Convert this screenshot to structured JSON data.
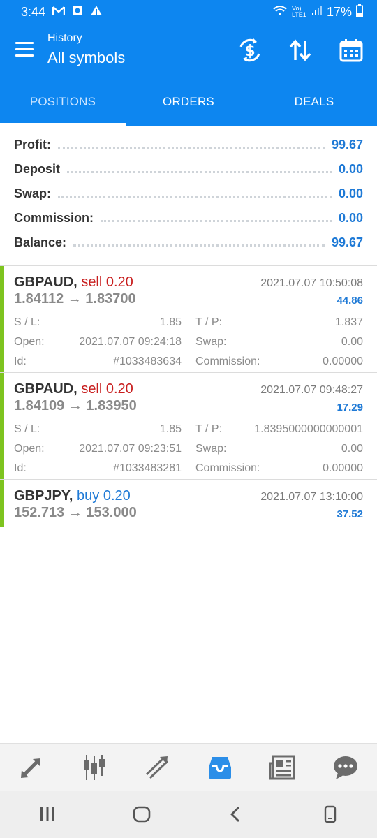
{
  "status_bar": {
    "time": "3:44",
    "battery": "17%",
    "signal_label": "Vo) LTE1"
  },
  "app_bar": {
    "subtitle": "History",
    "title": "All symbols"
  },
  "tabs": [
    {
      "label": "POSITIONS"
    },
    {
      "label": "ORDERS"
    },
    {
      "label": "DEALS"
    }
  ],
  "summary": [
    {
      "label": "Profit:",
      "value": "99.67"
    },
    {
      "label": "Deposit",
      "value": "0.00"
    },
    {
      "label": "Swap:",
      "value": "0.00"
    },
    {
      "label": "Commission:",
      "value": "0.00"
    },
    {
      "label": "Balance:",
      "value": "99.67"
    }
  ],
  "trades": [
    {
      "symbol": "GBPAUD,",
      "direction": "sell 0.20",
      "time": "2021.07.07 10:50:08",
      "prices": "1.84112 → 1.83700",
      "profit": "44.86",
      "sl_label": "S / L:",
      "sl": "1.85",
      "tp_label": "T / P:",
      "tp": "1.837",
      "open_label": "Open:",
      "open": "2021.07.07 09:24:18",
      "swap_label": "Swap:",
      "swap": "0.00",
      "id_label": "Id:",
      "id": "#1033483634",
      "commission_label": "Commission:",
      "commission": "0.00000"
    },
    {
      "symbol": "GBPAUD,",
      "direction": "sell 0.20",
      "time": "2021.07.07 09:48:27",
      "prices": "1.84109 → 1.83950",
      "profit": "17.29",
      "sl_label": "S / L:",
      "sl": "1.85",
      "tp_label": "T / P:",
      "tp": "1.8395000000000001",
      "open_label": "Open:",
      "open": "2021.07.07 09:23:51",
      "swap_label": "Swap:",
      "swap": "0.00",
      "id_label": "Id:",
      "id": "#1033483281",
      "commission_label": "Commission:",
      "commission": "0.00000"
    },
    {
      "symbol": "GBPJPY,",
      "direction": "buy 0.20",
      "time": "2021.07.07 13:10:00",
      "prices": "152.713 → 153.000",
      "profit": "37.52"
    }
  ],
  "colors": {
    "primary": "#0d86f0",
    "sell": "#c81e1e",
    "buy": "#1f7ad6",
    "indicator": "#7ec41f"
  },
  "bottom_nav": [
    "quotes-icon",
    "chart-icon",
    "trade-icon",
    "history-icon",
    "news-icon",
    "chat-icon"
  ]
}
